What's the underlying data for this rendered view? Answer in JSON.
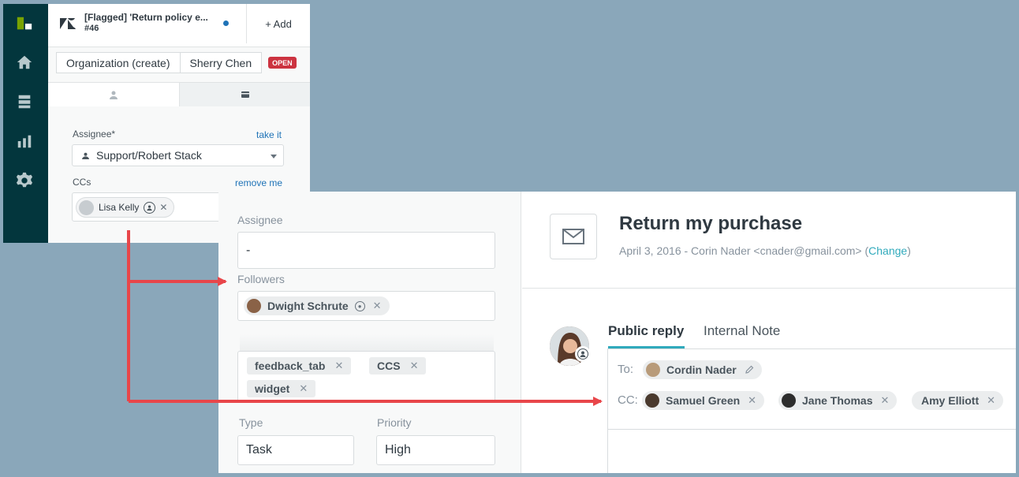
{
  "old_ui": {
    "ticket_tab": {
      "title": "[Flagged] 'Return policy e...",
      "number": "#46"
    },
    "add_button": "+ Add",
    "breadcrumbs": [
      "Organization (create)",
      "Sherry Chen"
    ],
    "status_badge": "OPEN",
    "assignee_label": "Assignee*",
    "take_it_link": "take it",
    "assignee_value": "Support/Robert Stack",
    "ccs_label": "CCs",
    "remove_me_link": "remove me",
    "cc_tag": "Lisa Kelly"
  },
  "new_ui": {
    "assignee_label": "Assignee",
    "assignee_value": "-",
    "followers_label": "Followers",
    "follower": "Dwight Schrute",
    "tags": [
      "feedback_tab",
      "CCS",
      "widget"
    ],
    "type_label": "Type",
    "type_value": "Task",
    "priority_label": "Priority",
    "priority_value": "High",
    "conversation": {
      "title": "Return my purchase",
      "meta": "April 3, 2016 - Corin Nader <cnader@gmail.com> (",
      "change_link": "Change",
      "meta_end": ")"
    },
    "reply_tabs": {
      "public": "Public reply",
      "internal": "Internal Note"
    },
    "to_label": "To:",
    "to_recipient": "Cordin Nader",
    "cc_label": "CC:",
    "cc_recipients": [
      "Samuel Green",
      "Jane Thomas",
      "Amy Elliott"
    ]
  },
  "colors": {
    "rail": "#03363d",
    "accent": "#30aabc",
    "link": "#1f73b7",
    "open_badge": "#cc3340",
    "arrow": "#e8464a",
    "background": "#8aa7ba"
  },
  "icons": [
    "zendesk-logo-icon",
    "home-icon",
    "views-icon",
    "reporting-icon",
    "settings-icon",
    "user-icon",
    "card-icon",
    "envelope-icon",
    "pencil-icon"
  ]
}
